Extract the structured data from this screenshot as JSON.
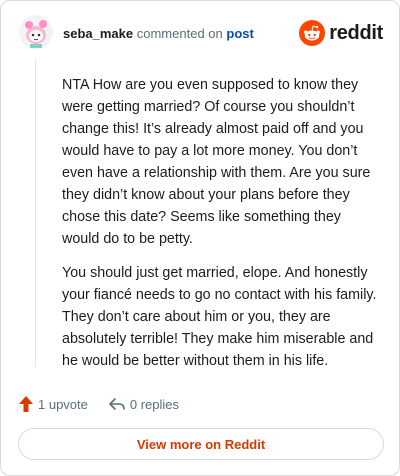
{
  "comment": {
    "username": "seba_make",
    "commented_text": "commented on",
    "post_link": "post",
    "paragraphs": [
      "NTA How are you even supposed to know they were getting married? Of course you shouldn’t change this! It’s already almost paid off and you would have to pay a lot more money. You don’t even have a relationship with them. Are you sure they didn’t know about your plans before they chose this date? Seems like something they would do to be petty.",
      "You should just get married, elope. And honestly your fiancé needs to go no contact with his family. They don’t care about him or you, they are absolutely terrible! They make him miserable and he would be better without them in his life."
    ]
  },
  "brand": {
    "name": "reddit",
    "logo_icon": "reddit-logo-icon",
    "color": "#ff4500"
  },
  "actions": {
    "upvote_label": "1 upvote",
    "upvote_icon": "upvote-arrow-icon",
    "upvote_color": "#d93900",
    "replies_label": "0 replies",
    "replies_icon": "reply-arrow-icon"
  },
  "footer": {
    "view_more_label": "View more on Reddit",
    "accent": "#d93900"
  }
}
